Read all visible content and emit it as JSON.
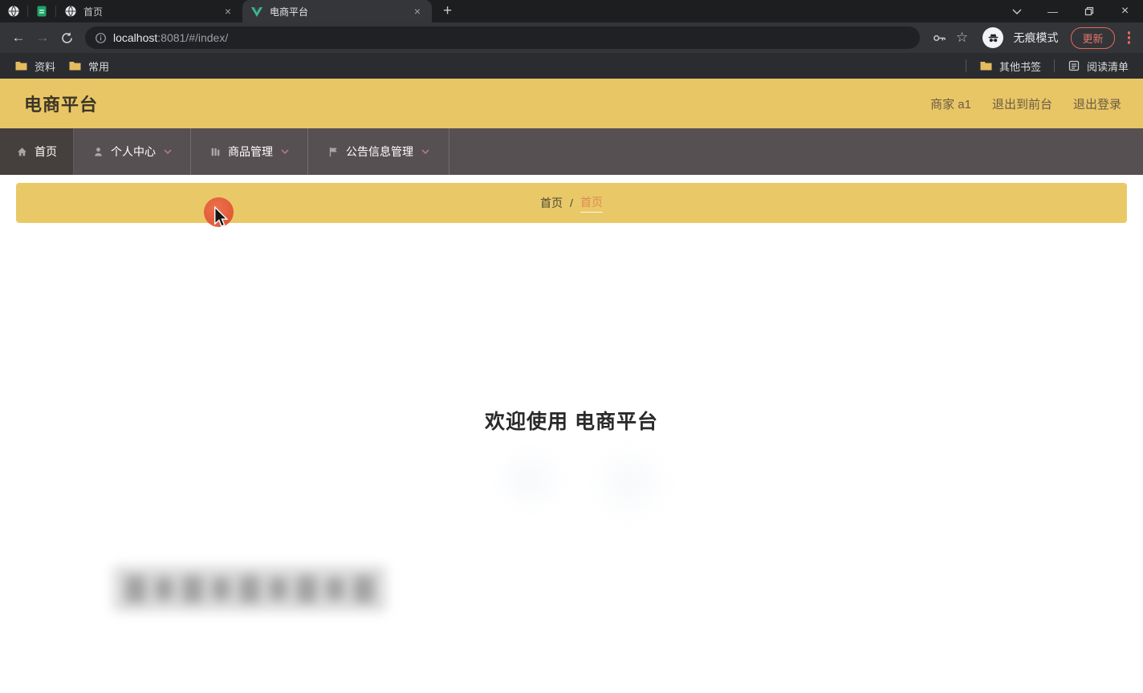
{
  "browser": {
    "tabs": [
      {
        "title": "首页",
        "active": false
      },
      {
        "title": "电商平台",
        "active": true
      }
    ],
    "address": {
      "host": "localhost",
      "path": ":8081/#/index/"
    },
    "incognito_label": "无痕模式",
    "update_label": "更新",
    "bookmarks": {
      "items": [
        "资料",
        "常用"
      ],
      "other_label": "其他书签",
      "reading_list_label": "阅读清单"
    },
    "glyphs": {
      "close": "×",
      "close_window": "×",
      "minimize": "—",
      "plus": "+",
      "back": "←",
      "forward": "→",
      "star": "☆"
    }
  },
  "app": {
    "header": {
      "title": "电商平台",
      "user_label": "商家 a1",
      "exit_front_label": "退出到前台",
      "logout_label": "退出登录"
    },
    "nav": [
      {
        "label": "首页",
        "icon": "home-icon",
        "active": true,
        "has_caret": false
      },
      {
        "label": "个人中心",
        "icon": "user-icon",
        "active": false,
        "has_caret": true
      },
      {
        "label": "商品管理",
        "icon": "bars-icon",
        "active": false,
        "has_caret": true
      },
      {
        "label": "公告信息管理",
        "icon": "flag-icon",
        "active": false,
        "has_caret": true
      }
    ],
    "breadcrumb": {
      "root": "首页",
      "separator": "/",
      "current": "首页"
    },
    "main": {
      "welcome_text": "欢迎使用 电商平台"
    }
  },
  "colors": {
    "header_yellow": "#e8c666",
    "breadcrumb_yellow": "#e9c967",
    "nav_gray": "#575052",
    "nav_active_gray": "#453f3e",
    "breadcrumb_current_orange": "#df8855",
    "update_red": "#e2695c",
    "vue_green": "#41b883",
    "click_indicator_red": "#e25a3a"
  }
}
